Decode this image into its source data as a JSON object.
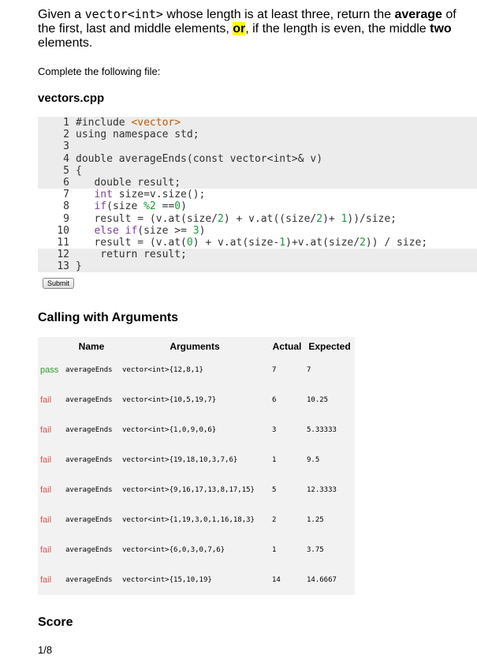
{
  "prompt": {
    "t1": "Given a ",
    "code1": "vector<int>",
    "t2": " whose length is at least three, return the ",
    "b1": "average",
    "t3": " of the first, last and middle elements, ",
    "hl": "or",
    "t4": ", if the length is even, the middle ",
    "b2": "two",
    "t5": " elements."
  },
  "instruction": "Complete the following file:",
  "filename": "vectors.cpp",
  "code_lines": [
    {
      "n": "1",
      "bg": "gray",
      "parts": [
        [
          "",
          "#include "
        ],
        [
          "str",
          "<vector>"
        ]
      ]
    },
    {
      "n": "2",
      "bg": "gray",
      "parts": [
        [
          "",
          "using namespace std;"
        ]
      ]
    },
    {
      "n": "3",
      "bg": "gray",
      "parts": [
        [
          "",
          ""
        ]
      ]
    },
    {
      "n": "4",
      "bg": "gray",
      "parts": [
        [
          "",
          "double averageEnds(const vector<int>& v)"
        ]
      ]
    },
    {
      "n": "5",
      "bg": "gray",
      "parts": [
        [
          "",
          "{"
        ]
      ]
    },
    {
      "n": "6",
      "bg": "gray",
      "parts": [
        [
          "",
          "   double result;"
        ]
      ]
    },
    {
      "n": "7",
      "bg": "white",
      "parts": [
        [
          "",
          "   "
        ],
        [
          "kw",
          "int"
        ],
        [
          "",
          " size=v.size();"
        ]
      ]
    },
    {
      "n": "8",
      "bg": "white",
      "parts": [
        [
          "",
          "   "
        ],
        [
          "kw",
          "if"
        ],
        [
          "",
          "(size "
        ],
        [
          "num",
          "%2"
        ],
        [
          "",
          " =="
        ],
        [
          "num",
          "0"
        ],
        [
          "",
          ")"
        ]
      ]
    },
    {
      "n": "9",
      "bg": "white",
      "parts": [
        [
          "",
          "   result = (v.at(size/"
        ],
        [
          "num",
          "2"
        ],
        [
          "",
          ") + v.at((size/"
        ],
        [
          "num",
          "2"
        ],
        [
          "",
          ")+ "
        ],
        [
          "num",
          "1"
        ],
        [
          "",
          "))/size;"
        ]
      ]
    },
    {
      "n": "10",
      "bg": "white",
      "parts": [
        [
          "",
          "   "
        ],
        [
          "kw",
          "else if"
        ],
        [
          "",
          "(size >= "
        ],
        [
          "num",
          "3"
        ],
        [
          "",
          ")"
        ]
      ]
    },
    {
      "n": "11",
      "bg": "white",
      "parts": [
        [
          "",
          "   result = (v.at("
        ],
        [
          "num",
          "0"
        ],
        [
          "",
          ") + v.at(size-"
        ],
        [
          "num",
          "1"
        ],
        [
          "",
          ")+v.at(size/"
        ],
        [
          "num",
          "2"
        ],
        [
          "",
          ")) / size;"
        ]
      ]
    },
    {
      "n": "12",
      "bg": "gray",
      "parts": [
        [
          "",
          "    return result;"
        ]
      ]
    },
    {
      "n": "13",
      "bg": "gray",
      "parts": [
        [
          "",
          "}"
        ]
      ]
    }
  ],
  "submit_label": "Submit",
  "calling_title": "Calling with Arguments",
  "table": {
    "headers": {
      "name": "Name",
      "arguments": "Arguments",
      "actual": "Actual",
      "expected": "Expected"
    },
    "rows": [
      {
        "status": "pass",
        "name": "averageEnds",
        "args": "vector<int>{12,8,1}",
        "actual": "7",
        "expected": "7"
      },
      {
        "status": "fail",
        "name": "averageEnds",
        "args": "vector<int>{10,5,19,7}",
        "actual": "6",
        "expected": "10.25"
      },
      {
        "status": "fail",
        "name": "averageEnds",
        "args": "vector<int>{1,0,9,0,6}",
        "actual": "3",
        "expected": "5.33333"
      },
      {
        "status": "fail",
        "name": "averageEnds",
        "args": "vector<int>{19,18,10,3,7,6}",
        "actual": "1",
        "expected": "9.5"
      },
      {
        "status": "fail",
        "name": "averageEnds",
        "args": "vector<int>{9,16,17,13,8,17,15}",
        "actual": "5",
        "expected": "12.3333"
      },
      {
        "status": "fail",
        "name": "averageEnds",
        "args": "vector<int>{1,19,3,0,1,16,18,3}",
        "actual": "2",
        "expected": "1.25"
      },
      {
        "status": "fail",
        "name": "averageEnds",
        "args": "vector<int>{6,0,3,0,7,6}",
        "actual": "1",
        "expected": "3.75"
      },
      {
        "status": "fail",
        "name": "averageEnds",
        "args": "vector<int>{15,10,19}",
        "actual": "14",
        "expected": "14.6667"
      }
    ]
  },
  "score_title": "Score",
  "score_value": "1/8"
}
